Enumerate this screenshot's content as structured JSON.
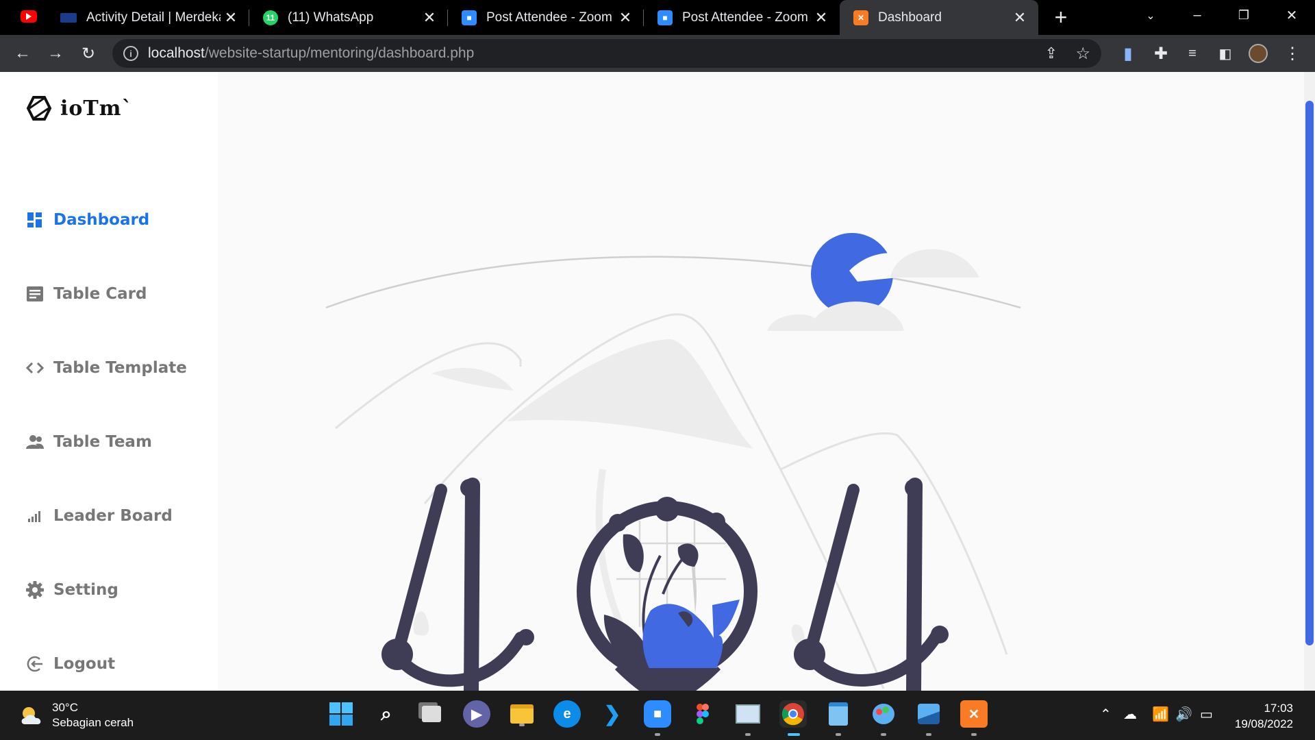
{
  "browser": {
    "tabs": [
      {
        "title": "Activity Detail | Merdeka",
        "icon": "kampus-merdeka-icon",
        "active": false
      },
      {
        "title": "(11) WhatsApp",
        "icon": "whatsapp-icon",
        "badge": "11",
        "active": false
      },
      {
        "title": "Post Attendee - Zoom",
        "icon": "zoom-icon",
        "active": false
      },
      {
        "title": "Post Attendee - Zoom",
        "icon": "zoom-icon",
        "active": false
      },
      {
        "title": "Dashboard",
        "icon": "xampp-icon",
        "active": true
      }
    ],
    "url_host": "localhost",
    "url_path": "/website-startup/mentoring/dashboard.php"
  },
  "sidebar": {
    "brand": "ioTm`",
    "items": [
      {
        "label": "Dashboard",
        "icon": "dashboard-grid-icon",
        "active": true
      },
      {
        "label": "Table Card",
        "icon": "card-icon",
        "active": false
      },
      {
        "label": "Table Template",
        "icon": "code-icon",
        "active": false
      },
      {
        "label": "Table Team",
        "icon": "team-icon",
        "active": false
      },
      {
        "label": "Leader Board",
        "icon": "bar-signal-icon",
        "active": false
      },
      {
        "label": "Setting",
        "icon": "gear-icon",
        "active": false
      },
      {
        "label": "Logout",
        "icon": "logout-icon",
        "active": false
      }
    ]
  },
  "taskbar": {
    "weather_temp": "30°C",
    "weather_desc": "Sebagian cerah",
    "time": "17:03",
    "date": "19/08/2022"
  },
  "colors": {
    "accent": "#1a73e8",
    "illustration_blue": "#4169e1",
    "illustration_dark": "#3f3d56"
  }
}
